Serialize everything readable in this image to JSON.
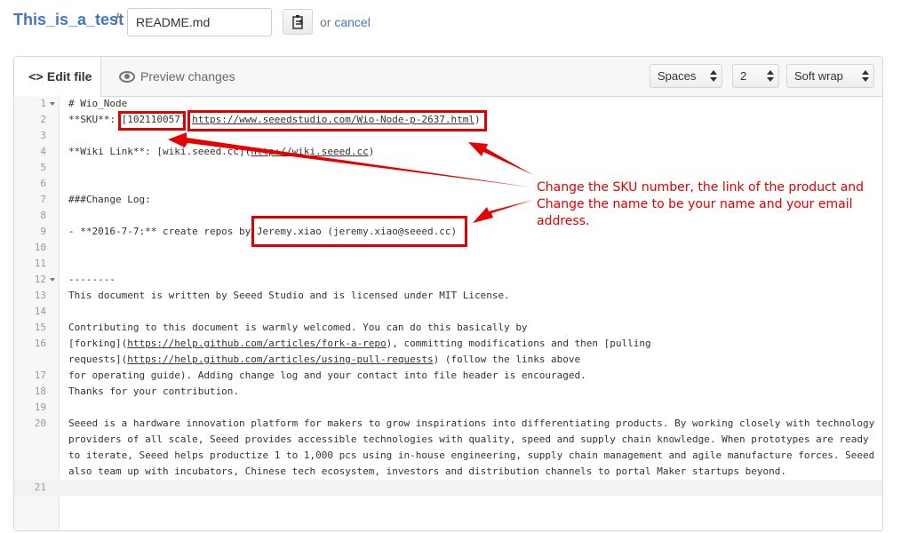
{
  "header": {
    "repo_name": "This_is_a_test",
    "separator": "/",
    "filename": "README.md",
    "or_text": "or",
    "cancel_label": "cancel"
  },
  "editor": {
    "tabs": {
      "edit_label": "Edit file",
      "preview_label": "Preview changes"
    },
    "options": {
      "indent_mode": "Spaces",
      "indent_size": "2",
      "wrap_mode": "Soft wrap"
    },
    "line_numbers": [
      "1",
      "2",
      "3",
      "4",
      "5",
      "6",
      "7",
      "8",
      "9",
      "10",
      "11",
      "12",
      "13",
      "14",
      "15",
      "16",
      "17",
      "18",
      "19",
      "20",
      "21"
    ],
    "code": {
      "l1": "# Wio_Node",
      "l2a": "**SKU**: ",
      "l2b": "[102110057]",
      "l2c": "(",
      "l2d": "https://www.seeedstudio.com/Wio-Node-p-2637.html",
      "l2e": ")",
      "l4a": "**Wiki Link**: [wiki.seeed.cc](",
      "l4b": "http://wiki.seeed.cc",
      "l4c": ")",
      "l7": "###Change Log:",
      "l9a": "- **2016-7-7:** create repos by ",
      "l9b": "Jeremy.xiao (jeremy.xiao@seeed.cc)",
      "l12": "--------",
      "l13": "This document is written by Seeed Studio and is licensed under MIT License.",
      "l15": "Contributing to this document is warmly welcomed. You can do this basically by",
      "l16a1": "[forking](",
      "l16a2": "https://help.github.com/articles/fork-a-repo",
      "l16a3": "), committing modifications and then [pulling",
      "l16b1": "requests](",
      "l16b2": "https://help.github.com/articles/using-pull-requests",
      "l16b3": ") (follow the links above",
      "l17": "for operating guide). Adding change log and your contact into file header is encouraged.",
      "l18": "Thanks for your contribution.",
      "l20a": "Seeed is a hardware innovation platform for makers to grow inspirations into differentiating products. By working closely with technology",
      "l20b": "providers of all scale, Seeed provides accessible technologies with quality, speed and supply chain knowledge. When prototypes are ready",
      "l20c": "to iterate, Seeed helps productize 1 to 1,000 pcs using in-house engineering, supply chain management and agile manufacture forces. Seeed",
      "l20d": "also team up with incubators, Chinese tech ecosystem, investors and distribution channels to portal Maker startups beyond."
    }
  },
  "annotation": {
    "line1": "Change the SKU number, the link of the product and",
    "line2": "Change the name to be your name and your email",
    "line3": "address."
  },
  "colors": {
    "link_blue": "#4078c0",
    "annotation_red": "#e00000"
  }
}
